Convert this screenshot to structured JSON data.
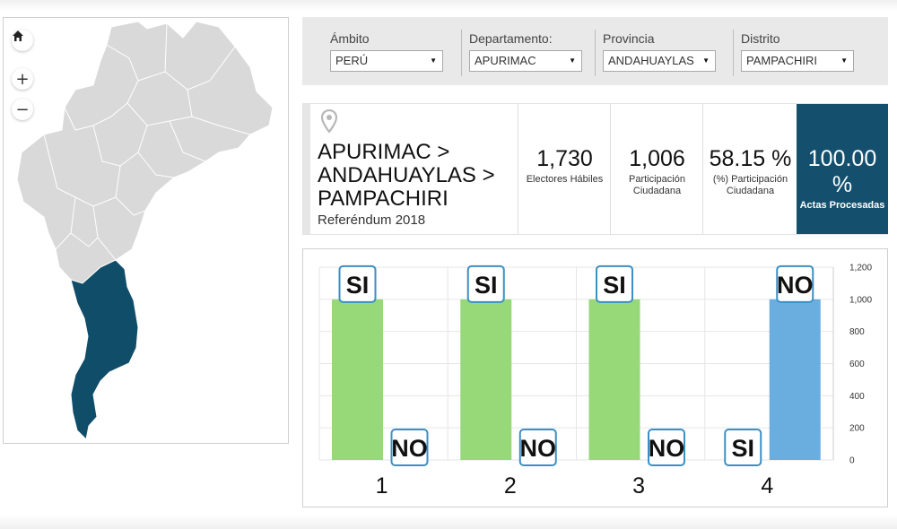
{
  "colors": {
    "map_region": "#d9d9d9",
    "map_selected": "#0f4d68",
    "bar_si": "#97d878",
    "bar_no": "#6aaee0",
    "final_stat_bg": "#14506e",
    "badge_border": "#3b8fc4"
  },
  "map_controls": [
    {
      "name": "home",
      "icon": "home-icon"
    },
    {
      "name": "zoom-in",
      "icon": "plus-icon",
      "glyph": "+"
    },
    {
      "name": "zoom-out",
      "icon": "minus-icon",
      "glyph": "−"
    }
  ],
  "filters": [
    {
      "label": "Ámbito",
      "value": "PERÚ"
    },
    {
      "label": "Departamento:",
      "value": "APURIMAC"
    },
    {
      "label": "Provincia",
      "value": "ANDAHUAYLAS"
    },
    {
      "label": "Distrito",
      "value": "PAMPACHIRI"
    }
  ],
  "location": {
    "icon": "map-pin-icon",
    "lines": [
      "APURIMAC >",
      "ANDAHUAYLAS >",
      "PAMPACHIRI"
    ],
    "subtitle": "Referéndum 2018"
  },
  "stats": [
    {
      "value": "1,730",
      "label_lines": [
        "Electores Hábiles"
      ]
    },
    {
      "value": "1,006",
      "label_lines": [
        "Participación",
        "Ciudadana"
      ]
    },
    {
      "value": "58.15 %",
      "label_lines": [
        "(%) Participación",
        "Ciudadana"
      ]
    },
    {
      "value": "100.00 %",
      "label_lines": [
        "Actas Procesadas"
      ]
    }
  ],
  "chart_data": {
    "type": "bar",
    "categories": [
      "1",
      "2",
      "3",
      "4"
    ],
    "series": [
      {
        "name": "SI",
        "values": [
          1000,
          1000,
          1000,
          0
        ]
      },
      {
        "name": "NO",
        "values": [
          0,
          0,
          0,
          1000
        ]
      }
    ],
    "winners": [
      "SI",
      "SI",
      "SI",
      "NO"
    ],
    "ylim": [
      0,
      1200
    ],
    "yticks": [
      "0",
      "200",
      "400",
      "600",
      "800",
      "1,000",
      "1,200"
    ],
    "ytick_values": [
      0,
      200,
      400,
      600,
      800,
      1000,
      1200
    ],
    "grid": true,
    "y_axis_side": "right"
  }
}
